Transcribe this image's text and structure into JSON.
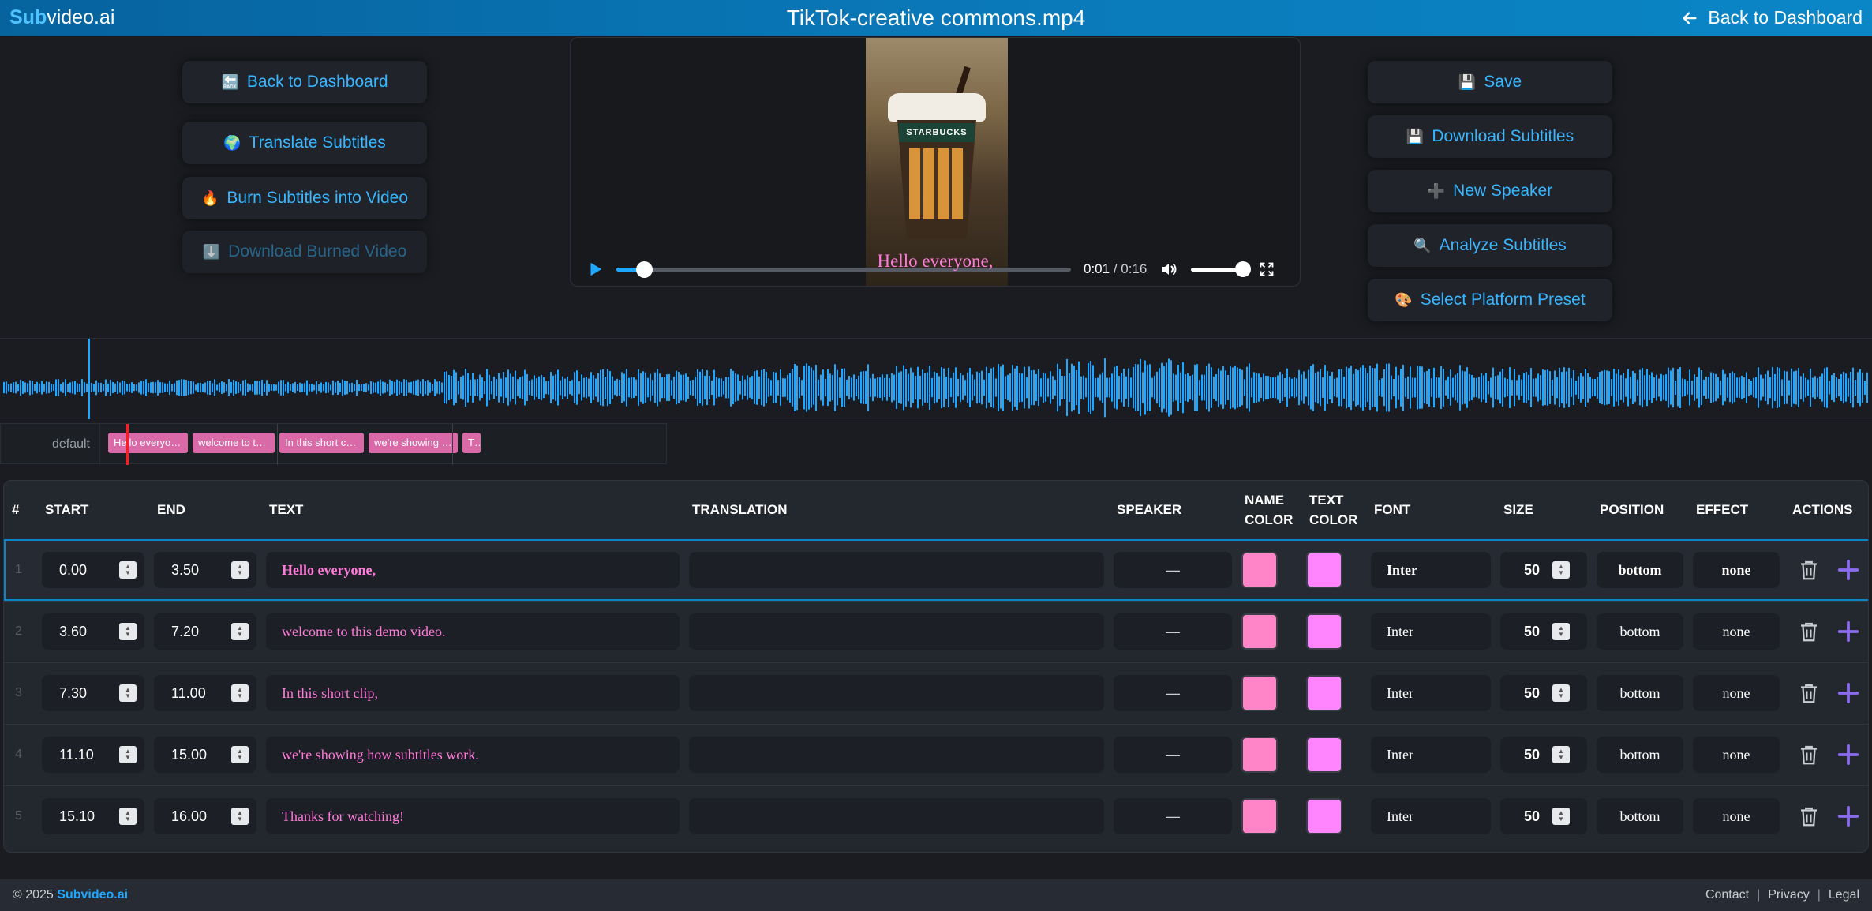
{
  "header": {
    "logo_accent": "Sub",
    "logo_rest": "video.ai",
    "title": "TikTok-creative commons.mp4",
    "back_label": "Back to Dashboard"
  },
  "left_actions": {
    "back": {
      "icon": "🔙",
      "label": "Back to Dashboard"
    },
    "translate": {
      "icon": "🌍",
      "label": "Translate Subtitles"
    },
    "burn": {
      "icon": "🔥",
      "label": "Burn Subtitles into Video"
    },
    "download_burned": {
      "icon": "⬇️",
      "label": "Download Burned Video"
    }
  },
  "right_actions": {
    "save": {
      "icon": "💾",
      "label": "Save"
    },
    "download_subs": {
      "icon": "💾",
      "label": "Download Subtitles"
    },
    "new_speaker": {
      "icon": "➕",
      "label": "New Speaker"
    },
    "analyze": {
      "icon": "🔍",
      "label": "Analyze Subtitles"
    },
    "preset": {
      "icon": "🎨",
      "label": "Select Platform Preset"
    }
  },
  "player": {
    "cup_brand": "STARBUCKS",
    "caption": "Hello everyone,",
    "current_time": "0:01",
    "duration": "/ 0:16",
    "progress_fraction": 0.06,
    "volume_fraction": 1.0
  },
  "timeline": {
    "track_label": "default",
    "chips": [
      {
        "text": "Hello everyone,",
        "start": 0.0,
        "end": 3.5
      },
      {
        "text": "welcome to this demo ...",
        "start": 3.6,
        "end": 7.2
      },
      {
        "text": "In this short clip,",
        "start": 7.3,
        "end": 11.0
      },
      {
        "text": "we're showing how subti...",
        "start": 11.1,
        "end": 15.0
      },
      {
        "text": "Th...",
        "start": 15.1,
        "end": 16.0
      }
    ],
    "playhead_time": 1.0
  },
  "table": {
    "headers": {
      "num": "#",
      "start": "START",
      "end": "END",
      "text": "TEXT",
      "translation": "TRANSLATION",
      "speaker": "SPEAKER",
      "name_color_1": "NAME",
      "name_color_2": "COLOR",
      "text_color_1": "TEXT",
      "text_color_2": "COLOR",
      "font": "FONT",
      "size": "SIZE",
      "position": "POSITION",
      "effect": "EFFECT",
      "actions": "ACTIONS"
    },
    "rows": [
      {
        "num": "1",
        "start": "0.00",
        "end": "3.50",
        "text": "Hello everyone,",
        "translation": "",
        "speaker": "—",
        "name_color": "#ff85c8",
        "text_color": "#ff85ff",
        "font": "Inter",
        "size": "50",
        "position": "bottom",
        "effect": "none"
      },
      {
        "num": "2",
        "start": "3.60",
        "end": "7.20",
        "text": "welcome to this demo video.",
        "translation": "",
        "speaker": "—",
        "name_color": "#ff85c8",
        "text_color": "#ff85ff",
        "font": "Inter",
        "size": "50",
        "position": "bottom",
        "effect": "none"
      },
      {
        "num": "3",
        "start": "7.30",
        "end": "11.00",
        "text": "In this short clip,",
        "translation": "",
        "speaker": "—",
        "name_color": "#ff85c8",
        "text_color": "#ff85ff",
        "font": "Inter",
        "size": "50",
        "position": "bottom",
        "effect": "none"
      },
      {
        "num": "4",
        "start": "11.10",
        "end": "15.00",
        "text": "we're showing how subtitles work.",
        "translation": "",
        "speaker": "—",
        "name_color": "#ff85c8",
        "text_color": "#ff85ff",
        "font": "Inter",
        "size": "50",
        "position": "bottom",
        "effect": "none"
      },
      {
        "num": "5",
        "start": "15.10",
        "end": "16.00",
        "text": "Thanks for watching!",
        "translation": "",
        "speaker": "—",
        "name_color": "#ff85c8",
        "text_color": "#ff85ff",
        "font": "Inter",
        "size": "50",
        "position": "bottom",
        "effect": "none"
      }
    ]
  },
  "footer": {
    "copyright": "© 2025",
    "brand": "Subvideo.ai",
    "links": [
      "Contact",
      "Privacy",
      "Legal"
    ],
    "separator": "|"
  },
  "colors": {
    "accent": "#1ea7ff",
    "header_gradient_start": "#06639e",
    "chip": "#d96aa7",
    "subtitle_text": "#ff7ad9",
    "waveform": "#1ea7ff"
  },
  "icons": {
    "header_back": "arrow-left-icon",
    "play": "play-icon",
    "volume": "speaker-icon",
    "fullscreen": "fullscreen-icon",
    "delete": "trash-icon",
    "add": "plus-icon"
  }
}
